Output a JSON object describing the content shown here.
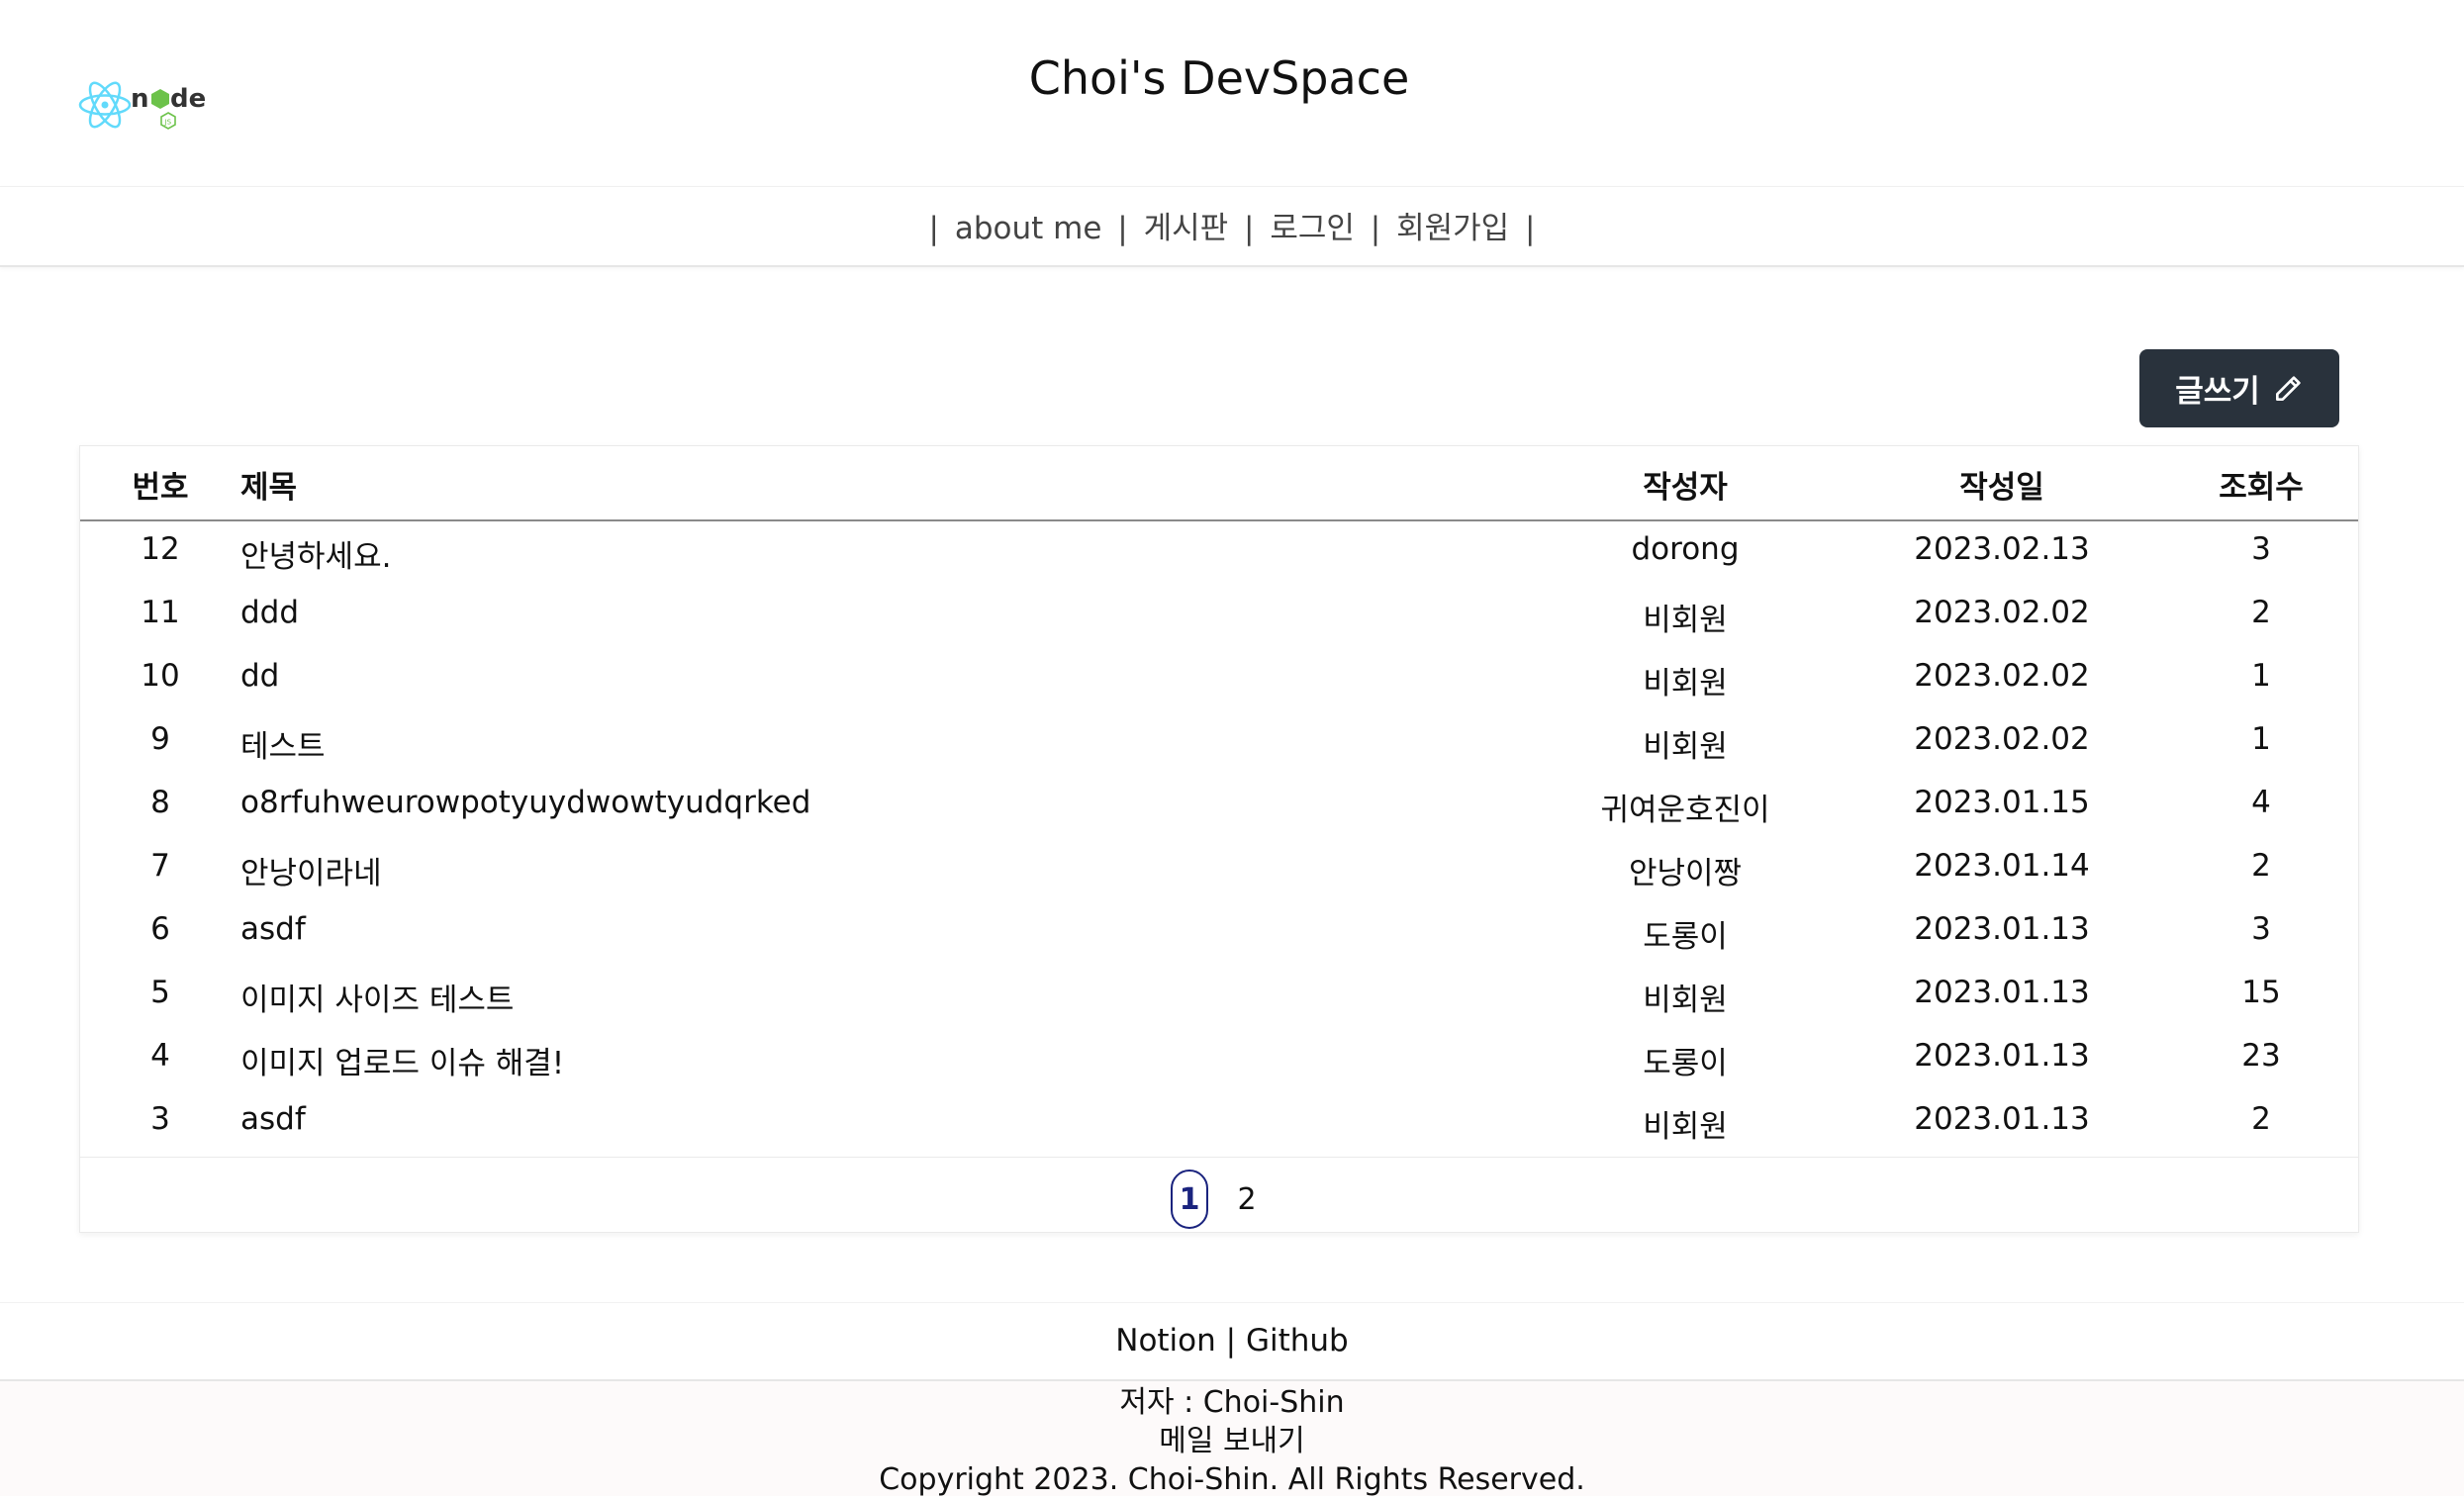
{
  "header": {
    "title": "Choi's DevSpace"
  },
  "nav": {
    "separator": "|",
    "items": [
      {
        "label": "about me"
      },
      {
        "label": "게시판"
      },
      {
        "label": "로그인"
      },
      {
        "label": "회원가입"
      }
    ]
  },
  "toolbar": {
    "write_label": "글쓰기"
  },
  "board": {
    "columns": {
      "num": "번호",
      "title": "제목",
      "author": "작성자",
      "date": "작성일",
      "views": "조회수"
    },
    "rows": [
      {
        "num": "12",
        "title": "안녕하세요.",
        "author": "dorong",
        "date": "2023.02.13",
        "views": "3"
      },
      {
        "num": "11",
        "title": "ddd",
        "author": "비회원",
        "date": "2023.02.02",
        "views": "2"
      },
      {
        "num": "10",
        "title": "dd",
        "author": "비회원",
        "date": "2023.02.02",
        "views": "1"
      },
      {
        "num": "9",
        "title": "테스트",
        "author": "비회원",
        "date": "2023.02.02",
        "views": "1"
      },
      {
        "num": "8",
        "title": "o8rfuhweurowpotyuydwowtyudqrked",
        "author": "귀여운호진이",
        "date": "2023.01.15",
        "views": "4"
      },
      {
        "num": "7",
        "title": "안낭이라네",
        "author": "안낭이짱",
        "date": "2023.01.14",
        "views": "2"
      },
      {
        "num": "6",
        "title": "asdf",
        "author": "도롱이",
        "date": "2023.01.13",
        "views": "3"
      },
      {
        "num": "5",
        "title": "이미지 사이즈 테스트",
        "author": "비회원",
        "date": "2023.01.13",
        "views": "15"
      },
      {
        "num": "4",
        "title": "이미지 업로드 이슈 해결!",
        "author": "도롱이",
        "date": "2023.01.13",
        "views": "23"
      },
      {
        "num": "3",
        "title": "asdf",
        "author": "비회원",
        "date": "2023.01.13",
        "views": "2"
      }
    ]
  },
  "pagination": {
    "pages": [
      "1",
      "2"
    ],
    "current": "1"
  },
  "footer": {
    "link_notion": "Notion",
    "separator": "|",
    "link_github": "Github",
    "author": "저자 : Choi-Shin",
    "mail": "메일 보내기",
    "copyright": "Copyright 2023. Choi-Shin. All Rights Reserved."
  },
  "colors": {
    "write_button_bg": "#29323c",
    "current_page": "#1a237e"
  },
  "icons": {
    "logo": "react-node-logo",
    "write": "pencil-icon"
  }
}
